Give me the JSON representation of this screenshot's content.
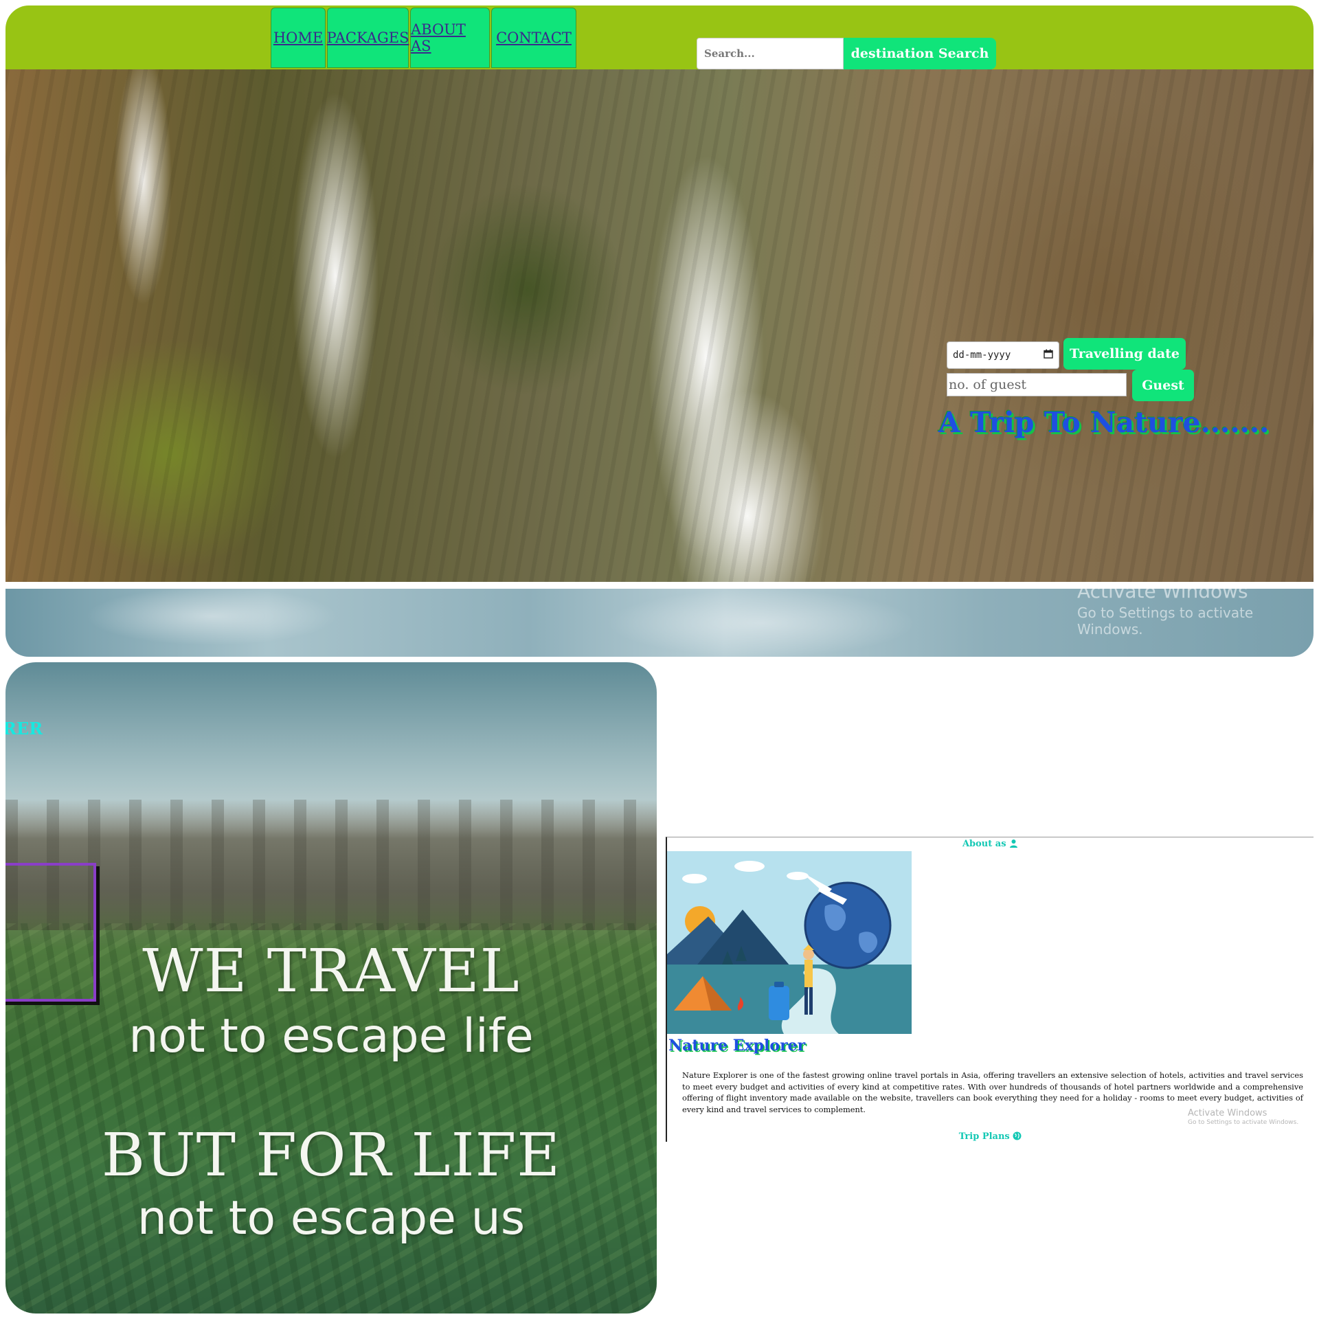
{
  "nav": {
    "items": [
      "HOME",
      "PACKAGES",
      "ABOUT AS",
      "CONTACT"
    ],
    "search_placeholder": "Search...",
    "search_button": "destination Search"
  },
  "hero": {
    "date_placeholder": "dd-mm-yyyy",
    "date_button": "Travelling date",
    "guest_placeholder": "no. of guest",
    "guest_button": "Guest",
    "tagline": "A Trip To Nature......."
  },
  "watermark": {
    "line1": "Activate Windows",
    "line2": "Go to Settings to activate Windows."
  },
  "poster": {
    "box_text": "RER",
    "line1": "WE TRAVEL",
    "line2": "not to escape life",
    "line3": "BUT FOR LIFE",
    "line4": "not to escape us"
  },
  "about": {
    "heading": "About as",
    "brand": "Nature Explorer",
    "paragraph": "Nature Explorer is one of the fastest growing online travel portals in Asia, offering travellers an extensive selection of hotels, activities and travel services to meet every budget and activities of every kind at competitive rates. With over hundreds of thousands of hotel partners worldwide and a comprehensive offering of flight inventory made available on the website, travellers can book everything they need for a holiday - rooms to meet every budget, activities of every kind and travel services to complement.",
    "trip_plans": "Trip Plans",
    "watermark_line1": "Activate Windows",
    "watermark_line2": "Go to Settings to activate Windows."
  },
  "colors": {
    "navbar": "#98c414",
    "accent_green": "#10e47a",
    "heading_blue": "#1f4fe0",
    "cyan_text": "#13c8b4"
  }
}
